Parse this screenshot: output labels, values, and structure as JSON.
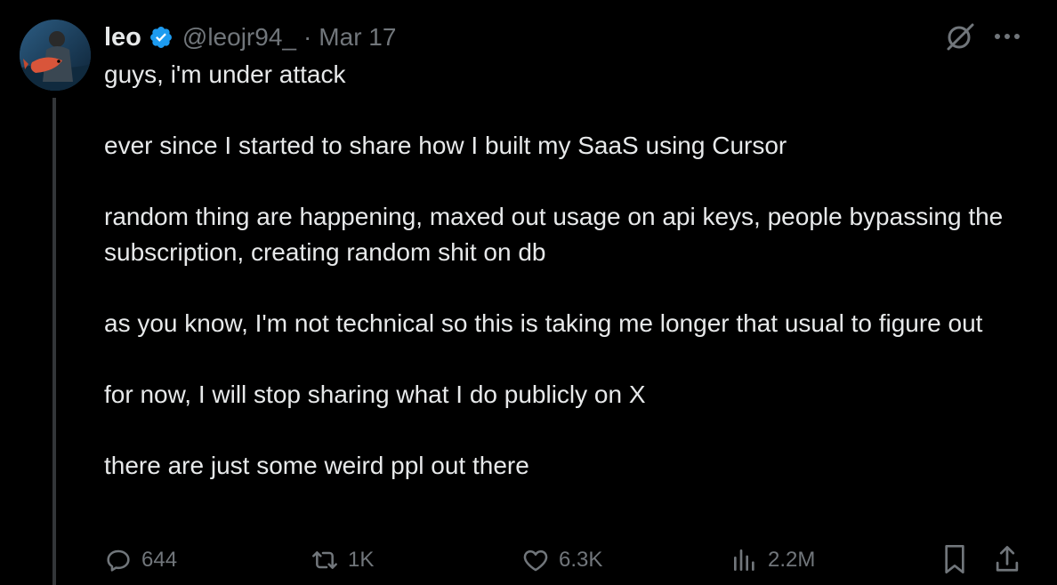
{
  "author": {
    "name": "leo",
    "handle": "@leojr94_",
    "separator": "·",
    "date": "Mar 17"
  },
  "post": {
    "paragraphs": [
      "guys, i'm under attack",
      "ever since I started to share how I built my SaaS using Cursor",
      "random thing are happening, maxed out usage on api keys, people bypassing the subscription, creating random shit on db",
      "as you know, I'm not technical so this is taking me longer that usual to figure out",
      "for now, I will stop sharing what I do publicly on X",
      "there are just some weird ppl out there"
    ]
  },
  "actions": {
    "replies": "644",
    "reposts": "1K",
    "likes": "6.3K",
    "views": "2.2M"
  },
  "icons": {
    "verified": "verified-badge-icon",
    "grok": "grok-icon",
    "more": "more-icon",
    "reply": "reply-icon",
    "repost": "repost-icon",
    "like": "heart-icon",
    "views": "views-icon",
    "bookmark": "bookmark-icon",
    "share": "share-icon"
  },
  "colors": {
    "background": "#000000",
    "text": "#e7e9ea",
    "muted": "#71767b",
    "verified": "#1d9bf0",
    "thread_line": "#333639"
  }
}
